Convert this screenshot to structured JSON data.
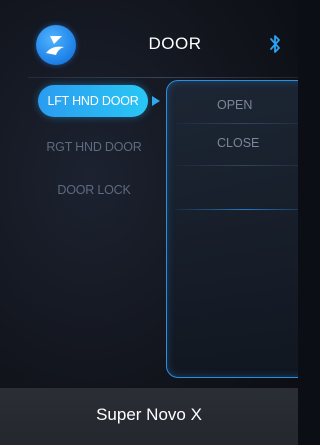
{
  "header": {
    "title": "DOOR",
    "logo_icon": "brand-logo-icon",
    "bluetooth_icon": "bluetooth-icon"
  },
  "sidebar": {
    "items": [
      {
        "label": "LFT HND DOOR",
        "active": true
      },
      {
        "label": "RGT HND DOOR",
        "active": false
      },
      {
        "label": "DOOR LOCK",
        "active": false
      }
    ]
  },
  "panel": {
    "options": [
      {
        "label": "OPEN"
      },
      {
        "label": "CLOSE"
      }
    ]
  },
  "footer": {
    "label": "Super Novo X"
  },
  "colors": {
    "accent": "#2a9cf0",
    "accent_light": "#29c7f5",
    "panel_border": "#2b8fe0",
    "footer_bg": "#2a2e35"
  }
}
